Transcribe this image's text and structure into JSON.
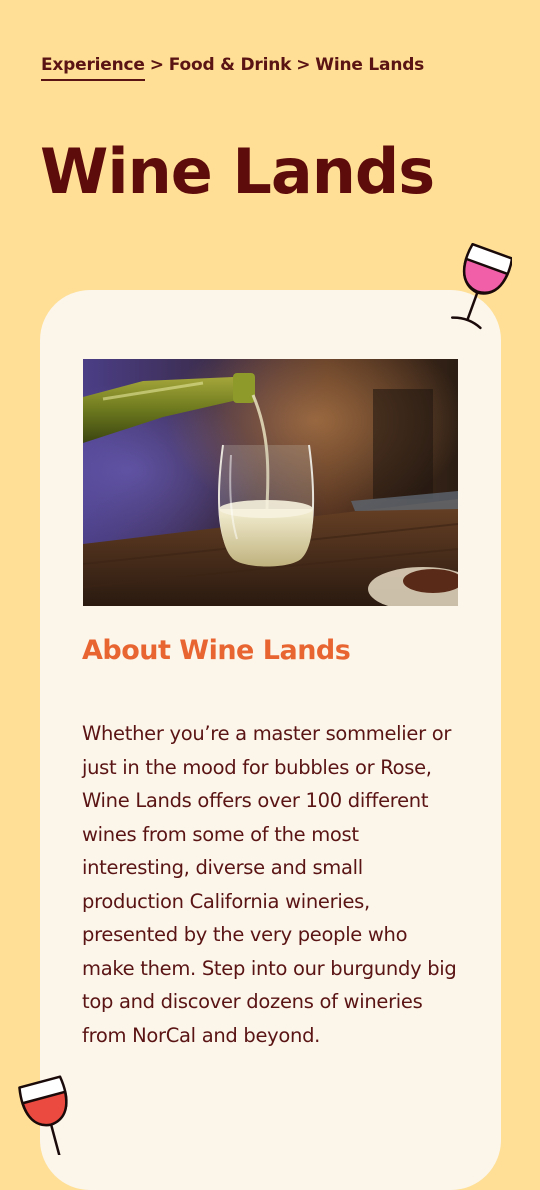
{
  "breadcrumb": {
    "items": [
      "Experience",
      "Food & Drink",
      "Wine Lands"
    ],
    "separator": ">"
  },
  "page": {
    "title": "Wine Lands"
  },
  "about": {
    "heading": "About Wine Lands",
    "body": "Whether you’re a master sommelier or just in the mood for bubbles or Rose, Wine Lands offers over 100 different wines from some of the most interesting, diverse and small production California wineries, presented by the very people who make them. Step into our burgundy big top and discover dozens of wineries from NorCal and beyond."
  },
  "decorations": {
    "top_icon": "wine-glass-pink-icon",
    "bottom_icon": "wine-glass-red-icon"
  },
  "colors": {
    "page_background": "#FFDF95",
    "card_background": "#FBF5EA",
    "title": "#5E0B0B",
    "heading_accent": "#E86532",
    "body_text": "#5A1414",
    "wine_pink": "#F05FA8",
    "wine_red": "#EA4A3F"
  }
}
